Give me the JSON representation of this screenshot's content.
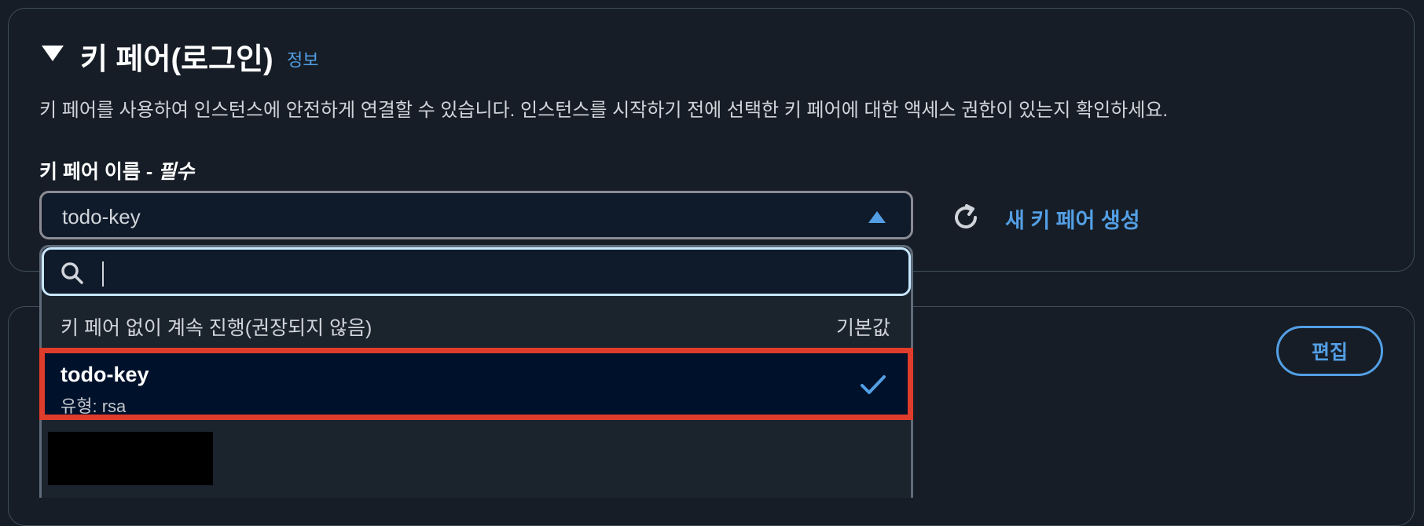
{
  "section": {
    "title": "키 페어(로그인)",
    "info_link": "정보",
    "description": "키 페어를 사용하여 인스턴스에 안전하게 연결할 수 있습니다. 인스턴스를 시작하기 전에 선택한 키 페어에 대한 액세스 권한이 있는지 확인하세요.",
    "field_label": "키 페어 이름 - ",
    "field_required": "필수",
    "selected_value": "todo-key",
    "create_link": "새 키 페어 생성"
  },
  "dropdown": {
    "search_value": "",
    "search_placeholder": "",
    "option_none_label": "키 페어 없이 계속 진행(권장되지 않음)",
    "option_none_tag": "기본값",
    "selected_option_name": "todo-key",
    "selected_option_type": "유형: rsa"
  },
  "next_section": {
    "edit_button": "편집"
  },
  "colors": {
    "accent": "#539fe5",
    "highlight_border": "#e03c2c",
    "background": "#161d26"
  },
  "icons": [
    "caret-down-icon",
    "caret-up-icon",
    "refresh-icon",
    "search-icon",
    "checkmark-icon"
  ]
}
